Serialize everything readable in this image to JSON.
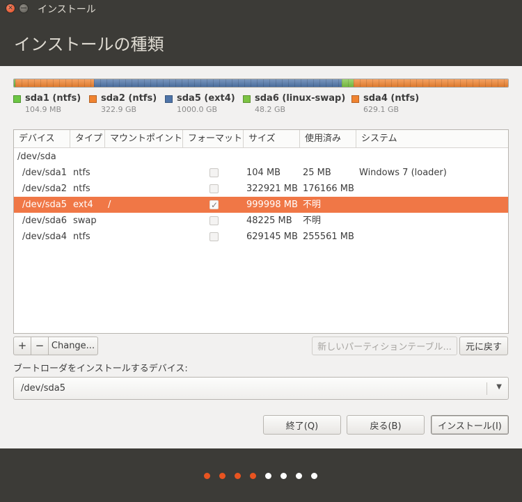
{
  "window": {
    "title": "インストール"
  },
  "header": {
    "title": "インストールの種類"
  },
  "partitions_bar": [
    {
      "name": "sda1 (ntfs)",
      "size": "104.9 MB",
      "color": "#6cc644"
    },
    {
      "name": "sda2 (ntfs)",
      "size": "322.9 GB",
      "color": "#f08330"
    },
    {
      "name": "sda5 (ext4)",
      "size": "1000.0 GB",
      "color": "#4e74a8"
    },
    {
      "name": "sda6 (linux-swap)",
      "size": "48.2 GB",
      "color": "#7cc343"
    },
    {
      "name": "sda4 (ntfs)",
      "size": "629.1 GB",
      "color": "#f08330"
    }
  ],
  "table": {
    "columns": [
      "デバイス",
      "タイプ",
      "マウントポイント",
      "フォーマット",
      "サイズ",
      "使用済み",
      "システム"
    ],
    "disk": "/dev/sda",
    "rows": [
      {
        "device": "/dev/sda1",
        "type": "ntfs",
        "mount": "",
        "format": false,
        "size": "104 MB",
        "used": "25 MB",
        "system": "Windows 7 (loader)",
        "selected": false
      },
      {
        "device": "/dev/sda2",
        "type": "ntfs",
        "mount": "",
        "format": false,
        "size": "322921 MB",
        "used": "176166 MB",
        "system": "",
        "selected": false
      },
      {
        "device": "/dev/sda5",
        "type": "ext4",
        "mount": "/",
        "format": true,
        "size": "999998 MB",
        "used": "不明",
        "system": "",
        "selected": true
      },
      {
        "device": "/dev/sda6",
        "type": "swap",
        "mount": "",
        "format": false,
        "size": "48225 MB",
        "used": "不明",
        "system": "",
        "selected": false
      },
      {
        "device": "/dev/sda4",
        "type": "ntfs",
        "mount": "",
        "format": false,
        "size": "629145 MB",
        "used": "255561 MB",
        "system": "",
        "selected": false
      }
    ]
  },
  "toolbar": {
    "add": "+",
    "remove": "−",
    "change": "Change..."
  },
  "new_partition_table": "新しいパーティションテーブル...",
  "revert": "元に戻す",
  "bootloader": {
    "label": "ブートローダをインストールするデバイス:",
    "value": "/dev/sda5"
  },
  "buttons": {
    "quit": "終了(Q)",
    "back": "戻る(B)",
    "install": "インストール(I)"
  },
  "progress": {
    "total_steps": 8,
    "completed_steps": 4,
    "active_color": "#e95420",
    "inactive_color": "#ffffff"
  }
}
